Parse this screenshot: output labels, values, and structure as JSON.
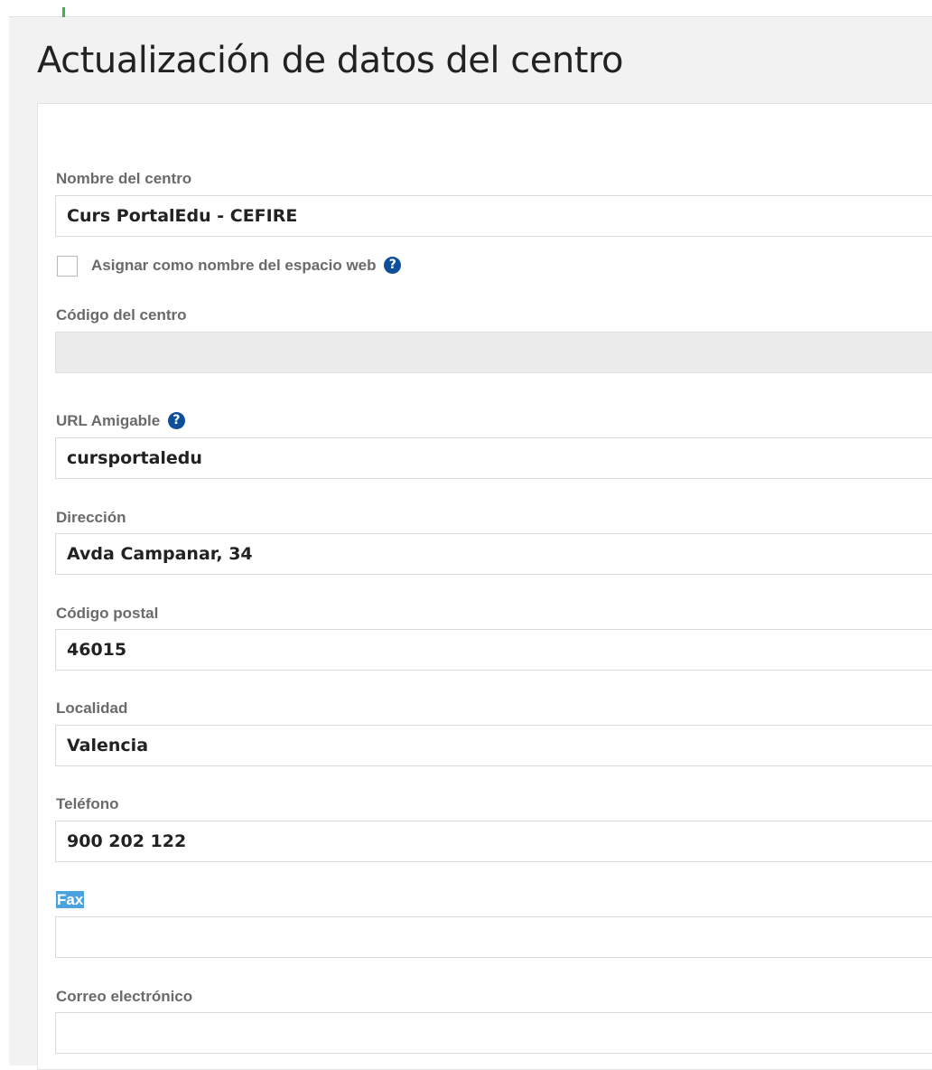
{
  "page": {
    "title": "Actualización de datos del centro"
  },
  "form": {
    "nombre_label": "Nombre del centro",
    "nombre_value": "Curs PortalEdu - CEFIRE",
    "asignar_label": "Asignar como nombre del espacio web",
    "help_glyph": "?",
    "codigo_label": "Código del centro",
    "codigo_value": "",
    "url_label": "URL Amigable",
    "url_value": "cursportaledu",
    "direccion_label": "Dirección",
    "direccion_value": "Avda Campanar, 34",
    "cp_label": "Código postal",
    "cp_value": "46015",
    "localidad_label": "Localidad",
    "localidad_value": "Valencia",
    "telefono_label": "Teléfono",
    "telefono_value": "900 202 122",
    "fax_label": "Fax",
    "fax_value": "",
    "email_label": "Correo electrónico",
    "email_value": ""
  },
  "state": {
    "asignar_checked": false
  },
  "colors": {
    "accent": "#3fb24a",
    "help_icon": "#0e4f9a",
    "selection": "#4aa3df"
  }
}
